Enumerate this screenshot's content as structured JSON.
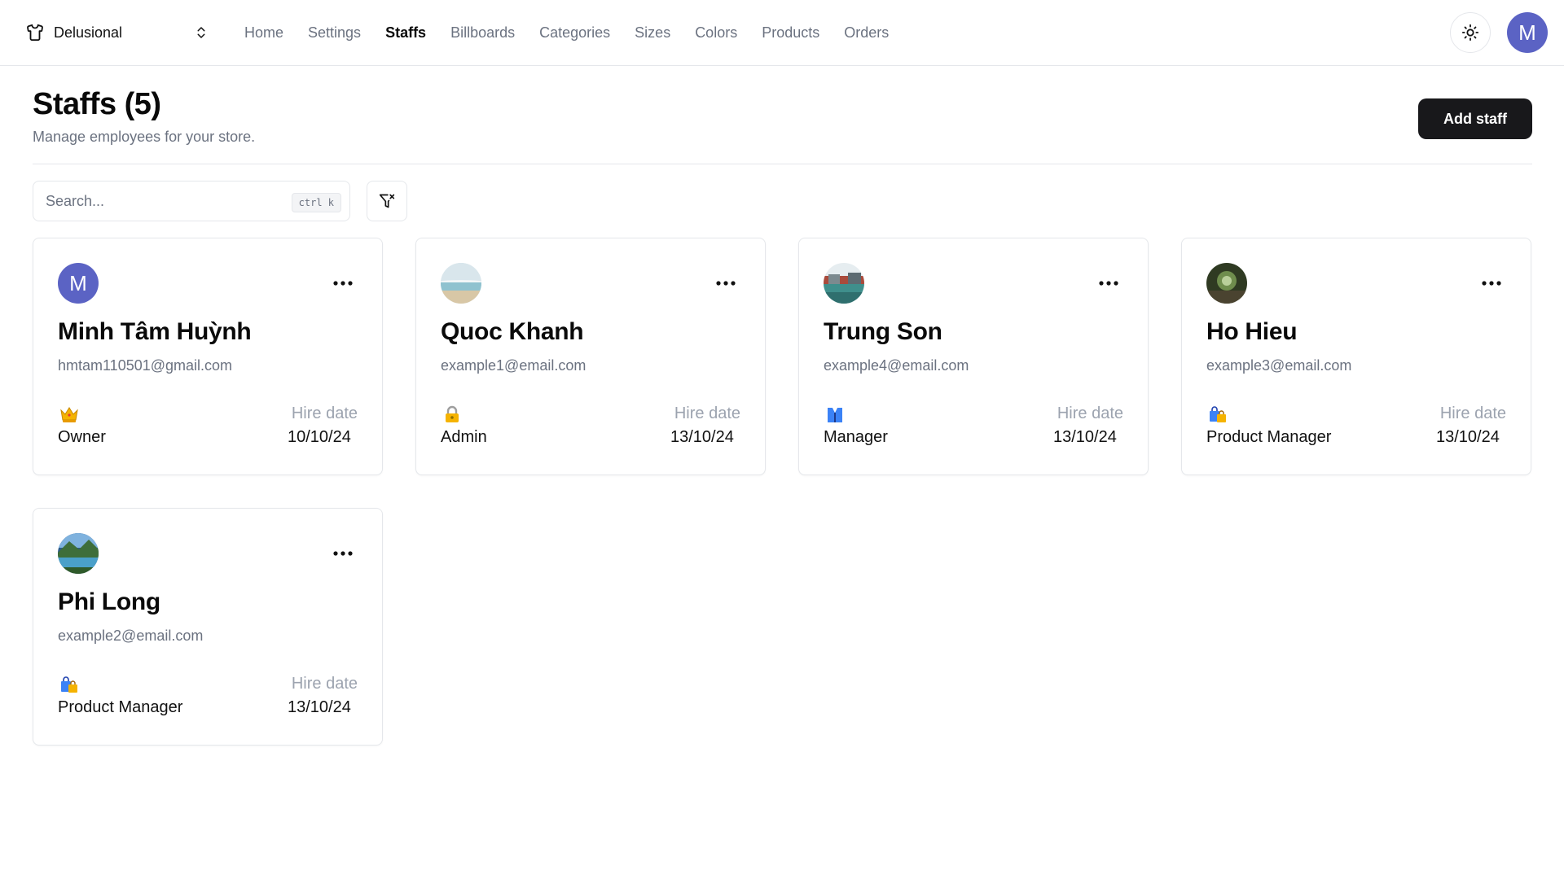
{
  "store": {
    "name": "Delusional"
  },
  "nav": [
    "Home",
    "Settings",
    "Staffs",
    "Billboards",
    "Categories",
    "Sizes",
    "Colors",
    "Products",
    "Orders"
  ],
  "nav_active": "Staffs",
  "user": {
    "initial": "M"
  },
  "header": {
    "title": "Staffs (5)",
    "description": "Manage employees for your store.",
    "add_button": "Add staff"
  },
  "search": {
    "placeholder": "Search...",
    "shortcut": "ctrl k"
  },
  "hire_label": "Hire date",
  "staffs": [
    {
      "name": "Minh Tâm Huỳnh",
      "email": "hmtam110501@gmail.com",
      "role": "Owner",
      "role_icon": "crown-icon",
      "hire_date": "10/10/24",
      "avatar": "letter-M",
      "avatar_initial": "M"
    },
    {
      "name": "Quoc Khanh",
      "email": "example1@email.com",
      "role": "Admin",
      "role_icon": "lock-icon",
      "hire_date": "13/10/24",
      "avatar": "beach-photo"
    },
    {
      "name": "Trung Son",
      "email": "example4@email.com",
      "role": "Manager",
      "role_icon": "vest-icon",
      "hire_date": "13/10/24",
      "avatar": "lake-photo"
    },
    {
      "name": "Ho Hieu",
      "email": "example3@email.com",
      "role": "Product Manager",
      "role_icon": "shopping-bags-icon",
      "hire_date": "13/10/24",
      "avatar": "cave-photo"
    },
    {
      "name": "Phi Long",
      "email": "example2@email.com",
      "role": "Product Manager",
      "role_icon": "shopping-bags-icon",
      "hire_date": "13/10/24",
      "avatar": "mountain-lake-photo"
    }
  ],
  "colors": {
    "accent_avatar": "#5b63c4",
    "primary_button": "#18181b",
    "muted_text": "#6b7280",
    "border": "#e5e7eb"
  }
}
